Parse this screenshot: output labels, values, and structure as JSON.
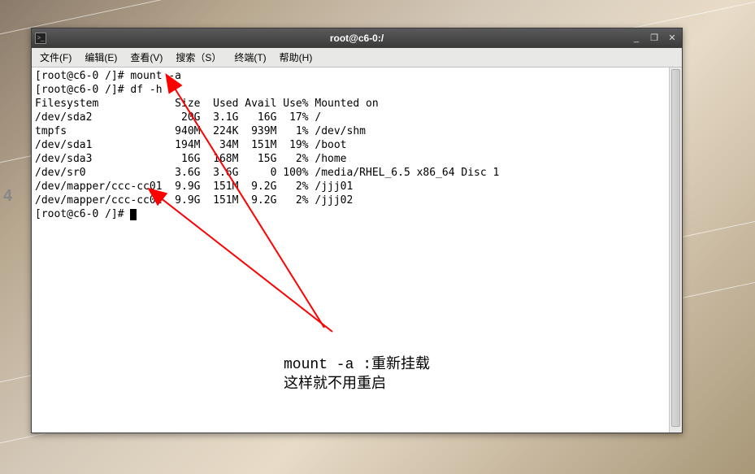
{
  "window": {
    "title": "root@c6-0:/",
    "terminal_icon": ">_"
  },
  "win_controls": {
    "minimize": "_",
    "maximize": "❐",
    "close": "✕"
  },
  "menubar": {
    "file": "文件(F)",
    "edit": "编辑(E)",
    "view": "查看(V)",
    "search": "搜索（S）",
    "terminal": "终端(T)",
    "help": "帮助(H)"
  },
  "term": {
    "line1": "[root@c6-0 /]# mount -a",
    "line2": "[root@c6-0 /]# df -h",
    "hdr": "Filesystem            Size  Used Avail Use% Mounted on",
    "r1": "/dev/sda2              20G  3.1G   16G  17% /",
    "r2": "tmpfs                 940M  224K  939M   1% /dev/shm",
    "r3": "/dev/sda1             194M   34M  151M  19% /boot",
    "r4": "/dev/sda3              16G  168M   15G   2% /home",
    "r5": "/dev/sr0              3.6G  3.6G     0 100% /media/RHEL_6.5 x86_64 Disc 1",
    "r6": "/dev/mapper/ccc-cc01  9.9G  151M  9.2G   2% /jjj01",
    "r7": "/dev/mapper/ccc-cc02  9.9G  151M  9.2G   2% /jjj02",
    "prompt": "[root@c6-0 /]# "
  },
  "annotation": {
    "line1": "mount -a :重新挂载",
    "line2": "这样就不用重启"
  },
  "watermark": "4"
}
